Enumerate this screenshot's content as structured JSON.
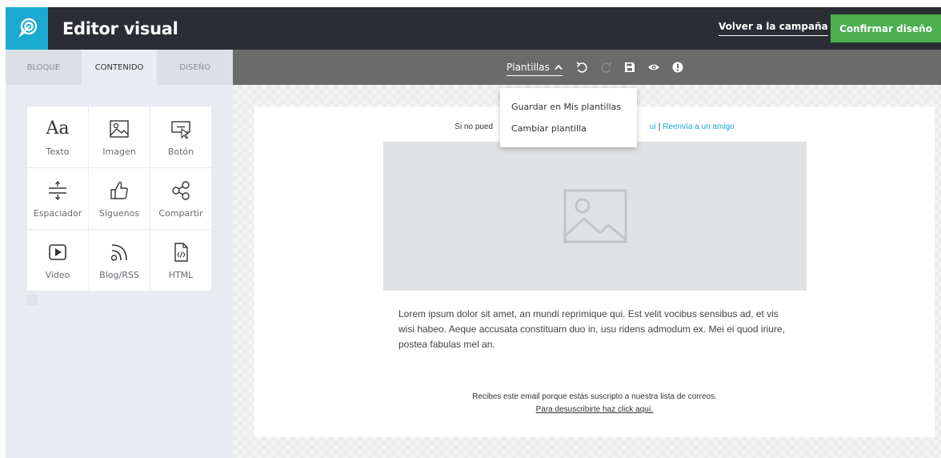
{
  "header": {
    "title": "Editor visual",
    "back_link": "Volver a la campaña",
    "confirm_button": "Confirmar diseño",
    "logo_icon": "rocket-target-icon",
    "colors": {
      "bar": "#2a2d33",
      "logo_bg": "#1aa9d1",
      "confirm": "#4caf50"
    }
  },
  "sidebar": {
    "tabs": [
      {
        "label": "BLOQUE",
        "active": false
      },
      {
        "label": "CONTENIDO",
        "active": true
      },
      {
        "label": "DISEÑO",
        "active": false
      }
    ],
    "blocks": [
      {
        "label": "Texto",
        "icon": "text-icon",
        "glyph": "Aa"
      },
      {
        "label": "Imagen",
        "icon": "image-icon"
      },
      {
        "label": "Botón",
        "icon": "button-icon"
      },
      {
        "label": "Espaciador",
        "icon": "spacer-icon"
      },
      {
        "label": "Síguenos",
        "icon": "thumbs-up-icon"
      },
      {
        "label": "Compartir",
        "icon": "share-icon"
      },
      {
        "label": "Video",
        "icon": "video-icon"
      },
      {
        "label": "Blog/RSS",
        "icon": "rss-icon"
      },
      {
        "label": "HTML",
        "icon": "html-file-icon"
      }
    ]
  },
  "toolbar": {
    "templates_label": "Plantillas",
    "icons": [
      "undo-icon",
      "redo-icon",
      "save-icon",
      "preview-eye-icon",
      "alert-icon"
    ]
  },
  "dropdown": {
    "items": [
      "Guardar en Mis plantillas",
      "Cambiar plantilla"
    ]
  },
  "email": {
    "top_text_start": "Si no pued",
    "top_text_link_end": "uí",
    "top_separator": " | ",
    "forward_link": "Reenvía a un amigo",
    "body": "Lorem ipsum dolor sit amet, an mundi reprimique qui. Est velit vocibus sensibus ad, et vis wisi habeo. Aeque accusata constituam duo in, usu ridens admodum ex. Mei ei quod iriure, postea fabulas mel an.",
    "footer_line1": "Recibes este email porque estás suscripto a nuestra lista de correos.",
    "footer_unsubscribe": "Para desuscribirte haz click aquí."
  }
}
